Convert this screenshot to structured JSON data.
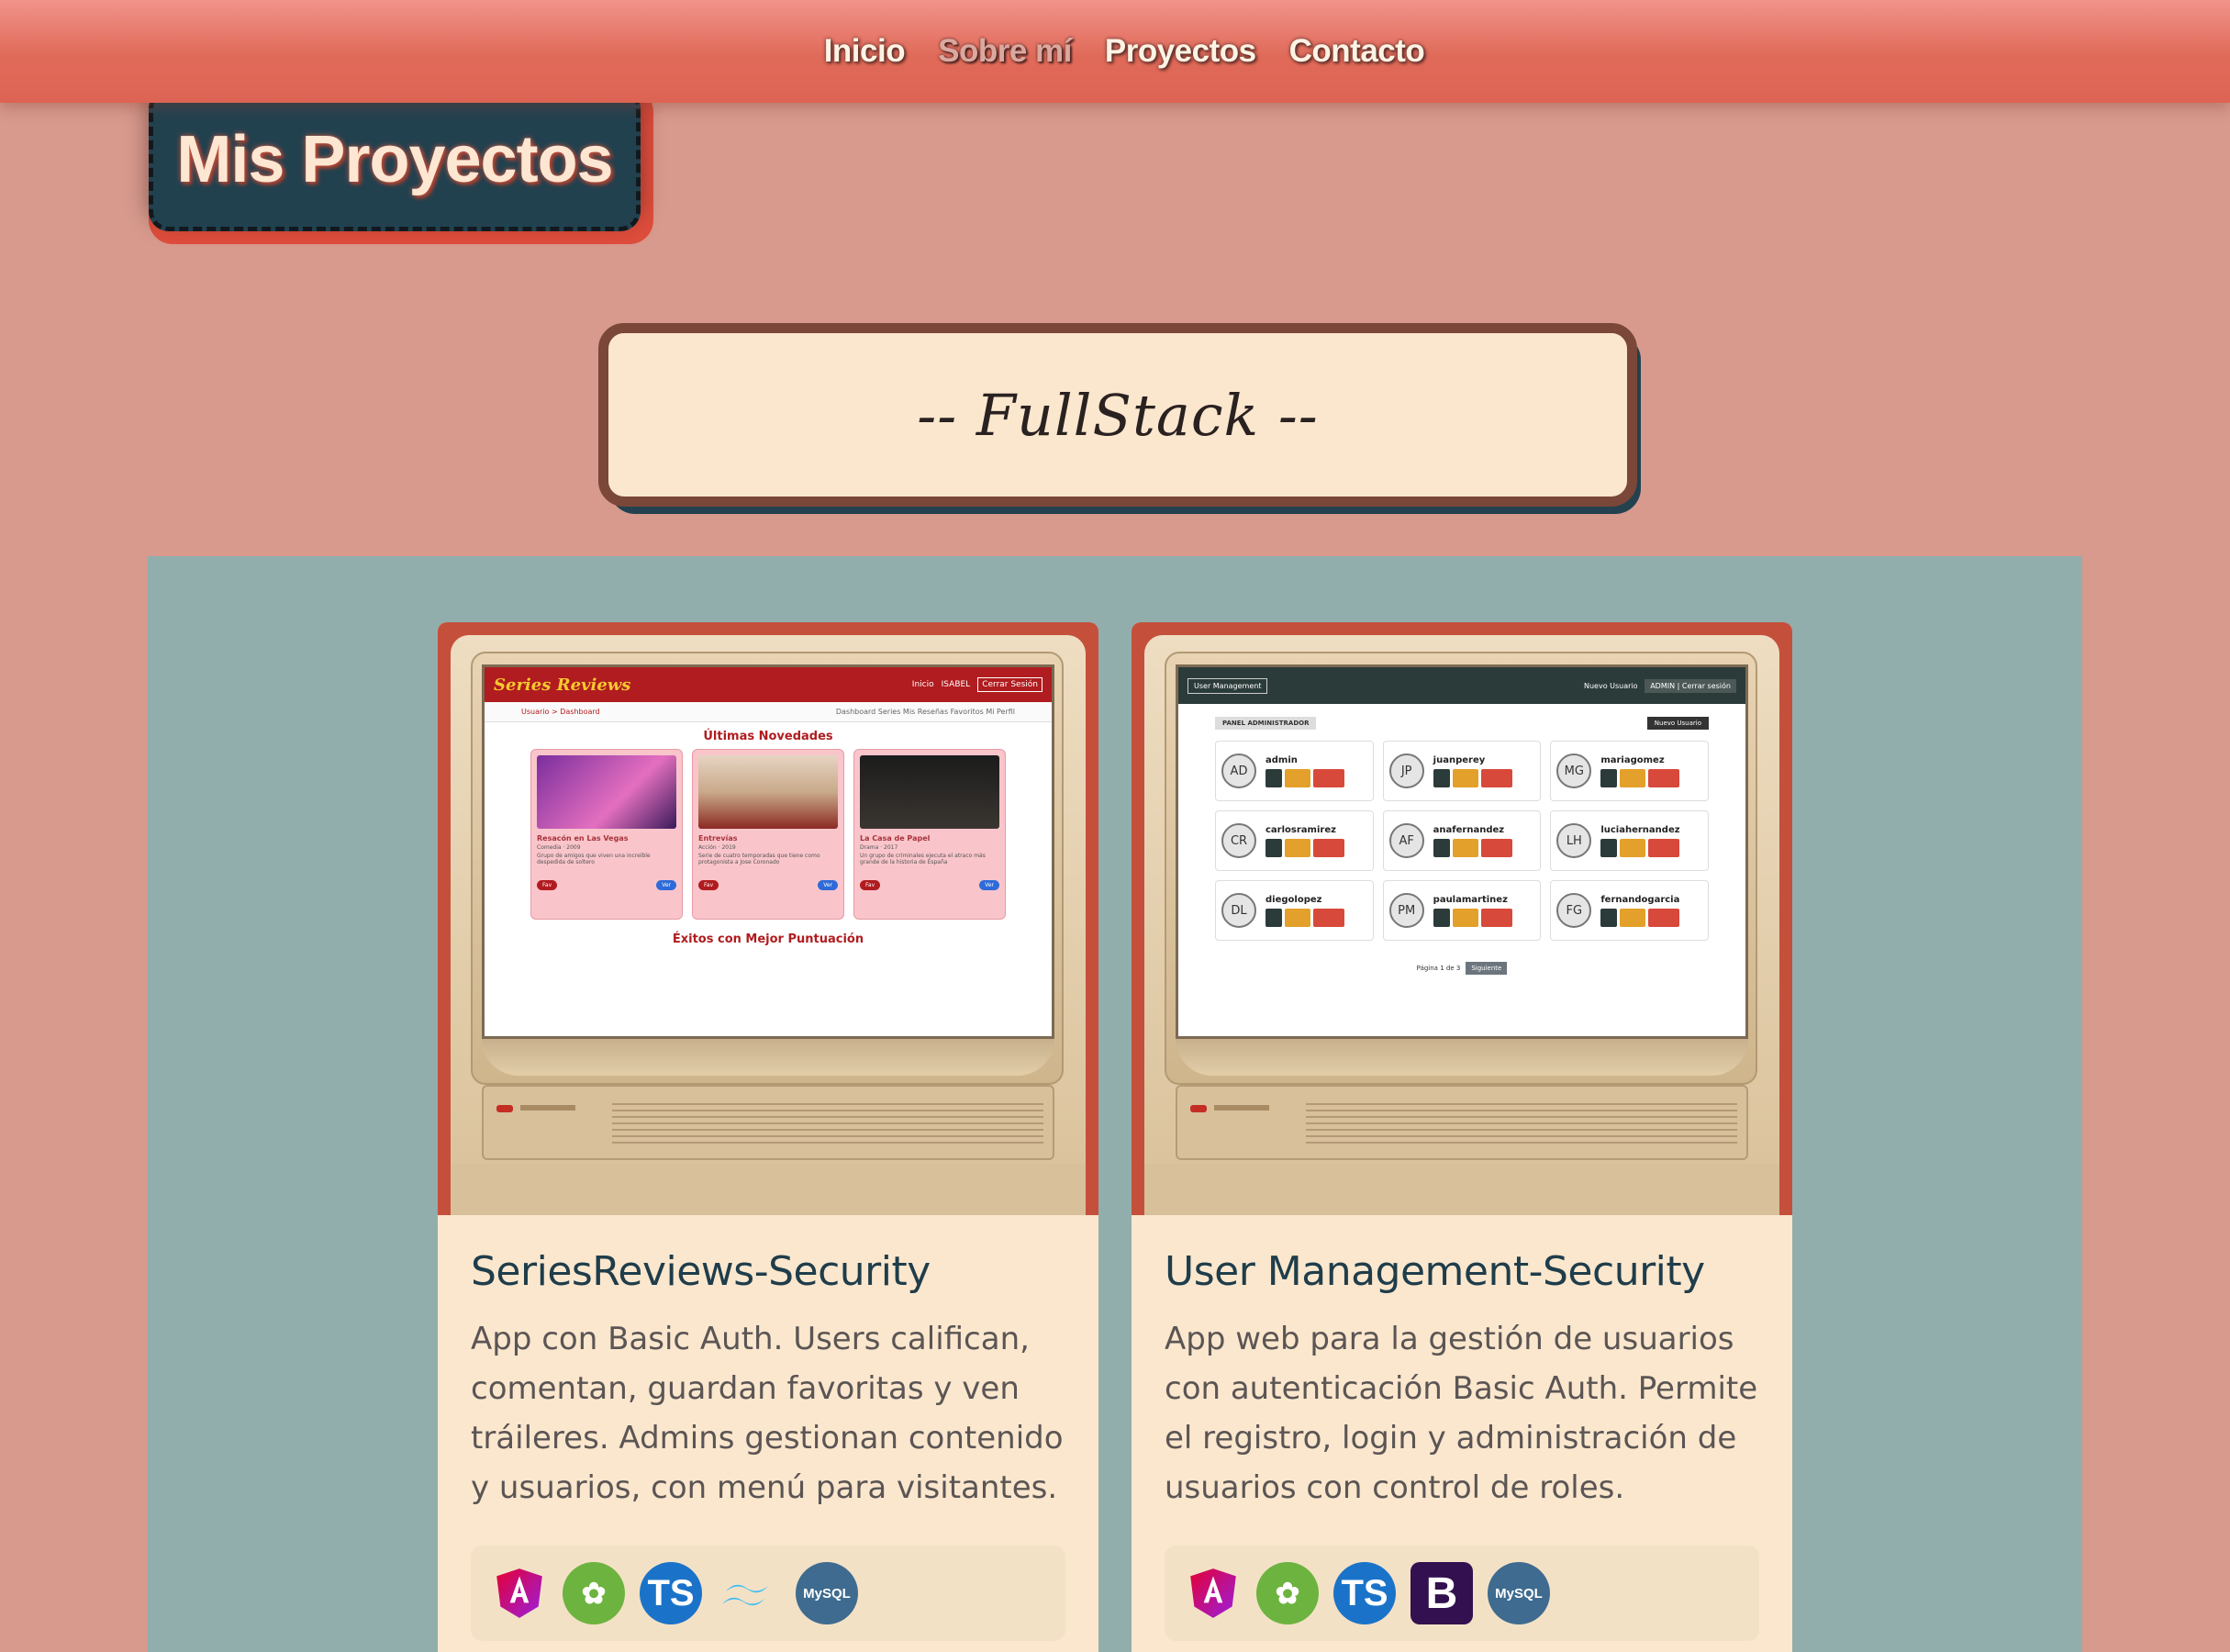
{
  "nav": {
    "items": [
      "Inicio",
      "Sobre mí",
      "Proyectos",
      "Contacto"
    ]
  },
  "page_title": "Mis Proyectos",
  "category_title": "-- FullStack --",
  "projects": [
    {
      "title": "SeriesReviews-Security",
      "description": "App con Basic Auth. Users califican, comentan, guardan favoritas y ven tráileres. Admins gestionan contenido y usuarios, con menú para visitantes.",
      "tech": [
        "angular-icon",
        "spring-icon",
        "typescript-icon",
        "tailwind-icon",
        "mysql-icon"
      ],
      "screen": {
        "brand": "Series Reviews",
        "header_links": [
          "Inicio",
          "ISABEL",
          "Cerrar Sesión"
        ],
        "breadcrumb": "Usuario > Dashboard",
        "subnav": "Dashboard  Series  Mis Reseñas  Favoritos  Mi Perfil",
        "section1": "Últimas Novedades",
        "section2": "Éxitos con Mejor Puntuación",
        "cards": [
          {
            "title": "Resacón en Las Vegas",
            "meta": "Comedia · 2009",
            "desc": "Grupo de amigos que viven una increíble despedida de soltero",
            "colors": [
              "#7b2e9e",
              "#e46fbf"
            ]
          },
          {
            "title": "Entrevías",
            "meta": "Acción · 2019",
            "desc": "Serie de cuatro temporadas que tiene como protagonista a Jose Coronado",
            "colors": [
              "#c9a98a",
              "#8b2a22"
            ]
          },
          {
            "title": "La Casa de Papel",
            "meta": "Drama · 2017",
            "desc": "Un grupo de criminales ejecuta el atraco más grande de la historia de España",
            "colors": [
              "#1c1c1c",
              "#3a3530"
            ]
          }
        ],
        "fav": "Fav",
        "ver": "Ver"
      }
    },
    {
      "title": "User Management-Security",
      "description": "App web para la gestión de usuarios con autenticación Basic Auth. Permite el registro, login y administración de usuarios con control de roles.",
      "tech": [
        "angular-icon",
        "spring-icon",
        "typescript-icon",
        "bootstrap-icon",
        "mysql-icon"
      ],
      "screen": {
        "header_left": "User Management",
        "header_new": "Nuevo Usuario",
        "header_admin": "ADMIN | Cerrar sesión",
        "panel": "PANEL ADMINISTRADOR",
        "new_user": "Nuevo Usuario",
        "users": [
          {
            "initials": "AD",
            "name": "admin"
          },
          {
            "initials": "JP",
            "name": "juanperey"
          },
          {
            "initials": "MG",
            "name": "mariagomez"
          },
          {
            "initials": "CR",
            "name": "carlosramirez"
          },
          {
            "initials": "AF",
            "name": "anafernandez"
          },
          {
            "initials": "LH",
            "name": "luciahernandez"
          },
          {
            "initials": "DL",
            "name": "diegolopez"
          },
          {
            "initials": "PM",
            "name": "paulamartinez"
          },
          {
            "initials": "FG",
            "name": "fernandogarcia"
          }
        ],
        "pagination": "Página 1 de 3",
        "next": "Siguiente"
      }
    }
  ],
  "tech_labels": {
    "ts": "TS",
    "mysql": "MySQL",
    "bootstrap": "B"
  },
  "colors": {
    "nav": "#e06a59",
    "title_bg": "#22414f",
    "accent": "#e04d3c",
    "section": "#91aeac",
    "card": "#fbe7cd"
  }
}
